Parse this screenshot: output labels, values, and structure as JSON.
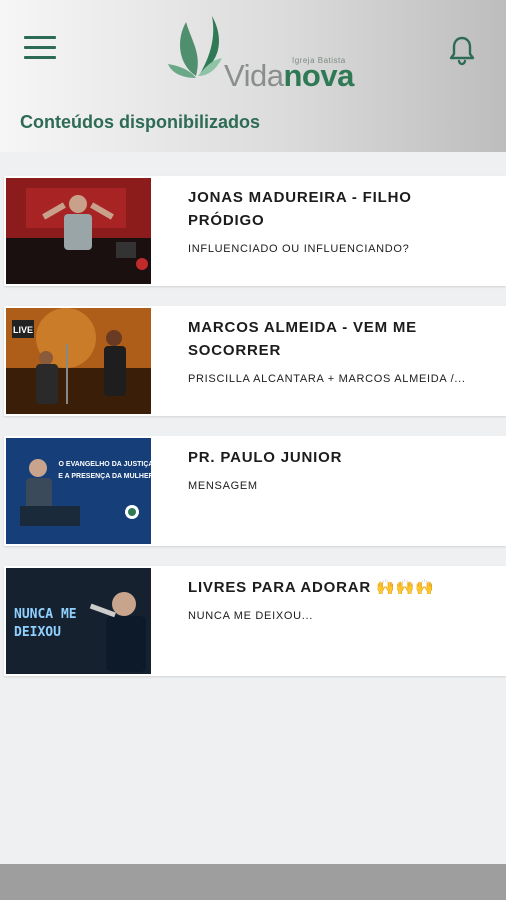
{
  "header": {
    "menu_icon": "hamburger-menu-icon",
    "notification_icon": "bell-icon",
    "logo": {
      "church_label": "Igreja Batista",
      "name_part1": "Vida",
      "name_part2": "nova"
    }
  },
  "section": {
    "title": "Conteúdos disponibilizados"
  },
  "videos": [
    {
      "title": "JONAS MADUREIRA - FILHO PRÓDIGO",
      "subtitle": "INFLUENCIADO OU INFLUENCIANDO?",
      "thumb_text": ""
    },
    {
      "title": "MARCOS ALMEIDA - VEM ME SOCORRER",
      "subtitle": "PRISCILLA ALCANTARA + MARCOS ALMEIDA /...",
      "thumb_text": "LIVE"
    },
    {
      "title": "PR. PAULO JUNIOR",
      "subtitle": "MENSAGEM",
      "thumb_text": "O EVANGELHO DA JUSTIÇA E A PRESENÇA DA MULHER"
    },
    {
      "title": "LIVRES PARA ADORAR 🙌🙌🙌",
      "subtitle": "NUNCA ME DEIXOU...",
      "thumb_text": "Nunca me deixou"
    }
  ],
  "colors": {
    "accent": "#2e6b55",
    "brand_green": "#2f7a55",
    "card_bg": "#ffffff",
    "page_bg": "#eef0f2"
  }
}
